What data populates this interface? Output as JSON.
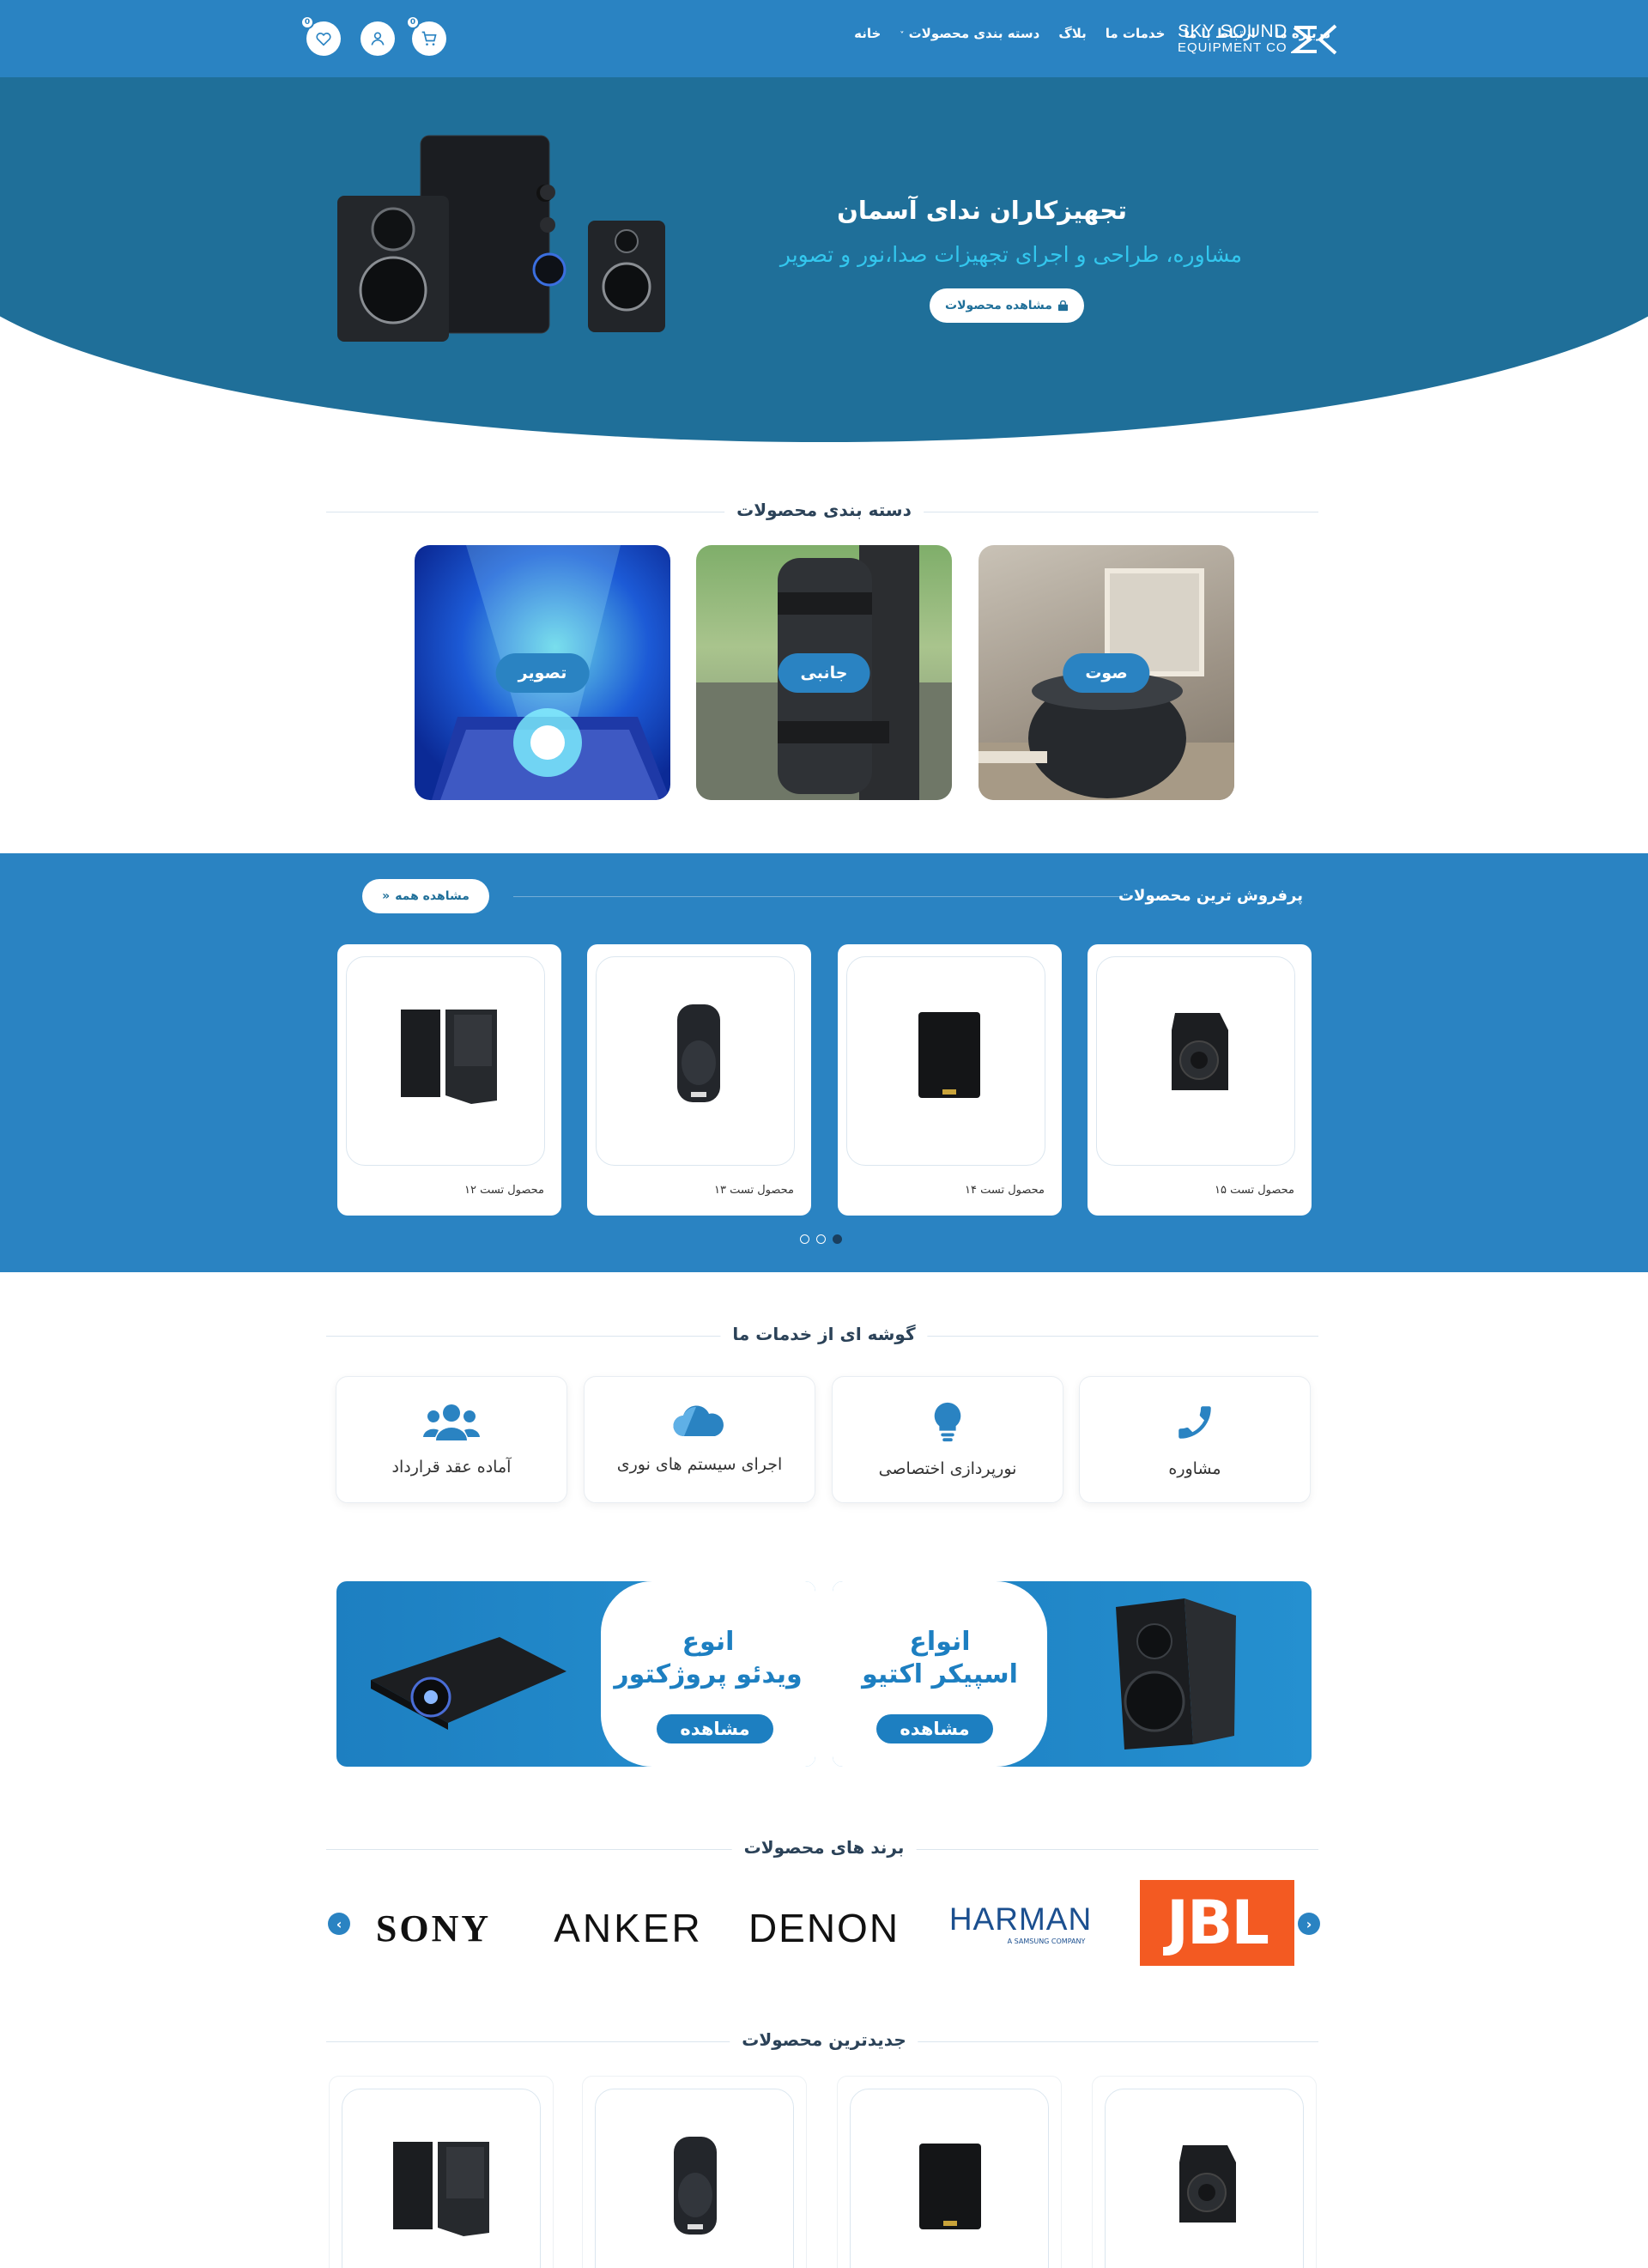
{
  "colors": {
    "primary": "#2a83c2",
    "hero": "#1f6f99",
    "accent": "#33c7ee"
  },
  "header": {
    "logo_line1": "SKY SOUND",
    "logo_line2": "EQUIPMENT CO",
    "wishlist_count": "0",
    "cart_count": "0",
    "nav": [
      "خانه",
      "دسته بندی محصولات",
      "بلاگ",
      "خدمات ما",
      "ارتباط با ما",
      "درباره ما"
    ]
  },
  "hero": {
    "title": "تجهیزکاران ندای آسمان",
    "subtitle": "مشاوره، طراحی و اجرای تجهیزات صدا،نور و تصویر",
    "button": "مشاهده محصولات"
  },
  "categories": {
    "title": "دسته بندی محصولات",
    "items": [
      {
        "label": "صوت"
      },
      {
        "label": "جانبی"
      },
      {
        "label": "تصویر"
      }
    ]
  },
  "bestsellers": {
    "title": "پرفروش ترین محصولات",
    "view_all": "مشاهده همه",
    "products": [
      {
        "name": "محصول تست ۱۵"
      },
      {
        "name": "محصول تست ۱۴"
      },
      {
        "name": "محصول تست ۱۳"
      },
      {
        "name": "محصول تست ۱۲"
      }
    ]
  },
  "services": {
    "title": "گوشه ای از خدمات ما",
    "items": [
      {
        "label": "مشاوره",
        "icon": "phone-icon"
      },
      {
        "label": "نورپردازی اختصاصی",
        "icon": "lightbulb-icon"
      },
      {
        "label": "اجرای سیستم های نوری",
        "icon": "cloud-icon"
      },
      {
        "label": "آماده عقد قرارداد",
        "icon": "users-icon"
      }
    ]
  },
  "banners": [
    {
      "line1": "انواع",
      "line2": "اسپیکر اکتیو",
      "button": "مشاهده"
    },
    {
      "line1": "انوع",
      "line2": "ویدئو پروژکتور",
      "button": "مشاهده"
    }
  ],
  "brands": {
    "title": "برند های محصولات",
    "items": [
      "JBL",
      "HARMAN",
      "DENON",
      "ANKER",
      "SONY"
    ],
    "harman_sub": "A SAMSUNG COMPANY"
  },
  "newest": {
    "title": "جدیدترین محصولات"
  }
}
